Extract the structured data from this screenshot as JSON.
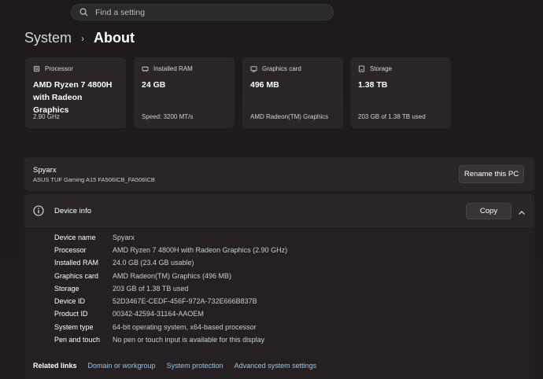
{
  "search": {
    "placeholder": "Find a setting"
  },
  "breadcrumb": {
    "parent": "System",
    "separator": "›",
    "current": "About"
  },
  "cards": [
    {
      "label": "Processor",
      "value": "AMD Ryzen 7 4800H with Radeon Graphics",
      "sub": "2.90 GHz",
      "icon": "cpu-icon"
    },
    {
      "label": "Installed RAM",
      "value": "24 GB",
      "sub": "Speed: 3200 MT/s",
      "icon": "ram-icon"
    },
    {
      "label": "Graphics card",
      "value": "496 MB",
      "sub": "AMD Radeon(TM) Graphics",
      "icon": "gpu-icon"
    },
    {
      "label": "Storage",
      "value": "1.38 TB",
      "sub": "203 GB of 1.38 TB used",
      "icon": "storage-icon"
    }
  ],
  "pc": {
    "name": "Spyarx",
    "model": "ASUS TUF Gaming A15 FA506ICB_FA506ICB",
    "rename_label": "Rename this PC"
  },
  "device_info": {
    "title": "Device info",
    "copy_label": "Copy",
    "rows": [
      {
        "key": "Device name",
        "value": "Spyarx"
      },
      {
        "key": "Processor",
        "value": "AMD Ryzen 7 4800H with Radeon Graphics (2.90 GHz)"
      },
      {
        "key": "Installed RAM",
        "value": "24.0 GB (23.4 GB usable)"
      },
      {
        "key": "Graphics card",
        "value": "AMD Radeon(TM) Graphics (496 MB)"
      },
      {
        "key": "Storage",
        "value": "203 GB of 1.38 TB used"
      },
      {
        "key": "Device ID",
        "value": "52D3467E-CEDF-456F-972A-732E666B837B"
      },
      {
        "key": "Product ID",
        "value": "00342-42594-31164-AAOEM"
      },
      {
        "key": "System type",
        "value": "64-bit operating system, x64-based processor"
      },
      {
        "key": "Pen and touch",
        "value": "No pen or touch input is available for this display"
      }
    ]
  },
  "related": {
    "label": "Related links",
    "links": [
      "Domain or workgroup",
      "System protection",
      "Advanced system settings"
    ]
  },
  "colors": {
    "background": "#221c1e",
    "card": "#2b2527",
    "link": "#8fc8ee"
  }
}
